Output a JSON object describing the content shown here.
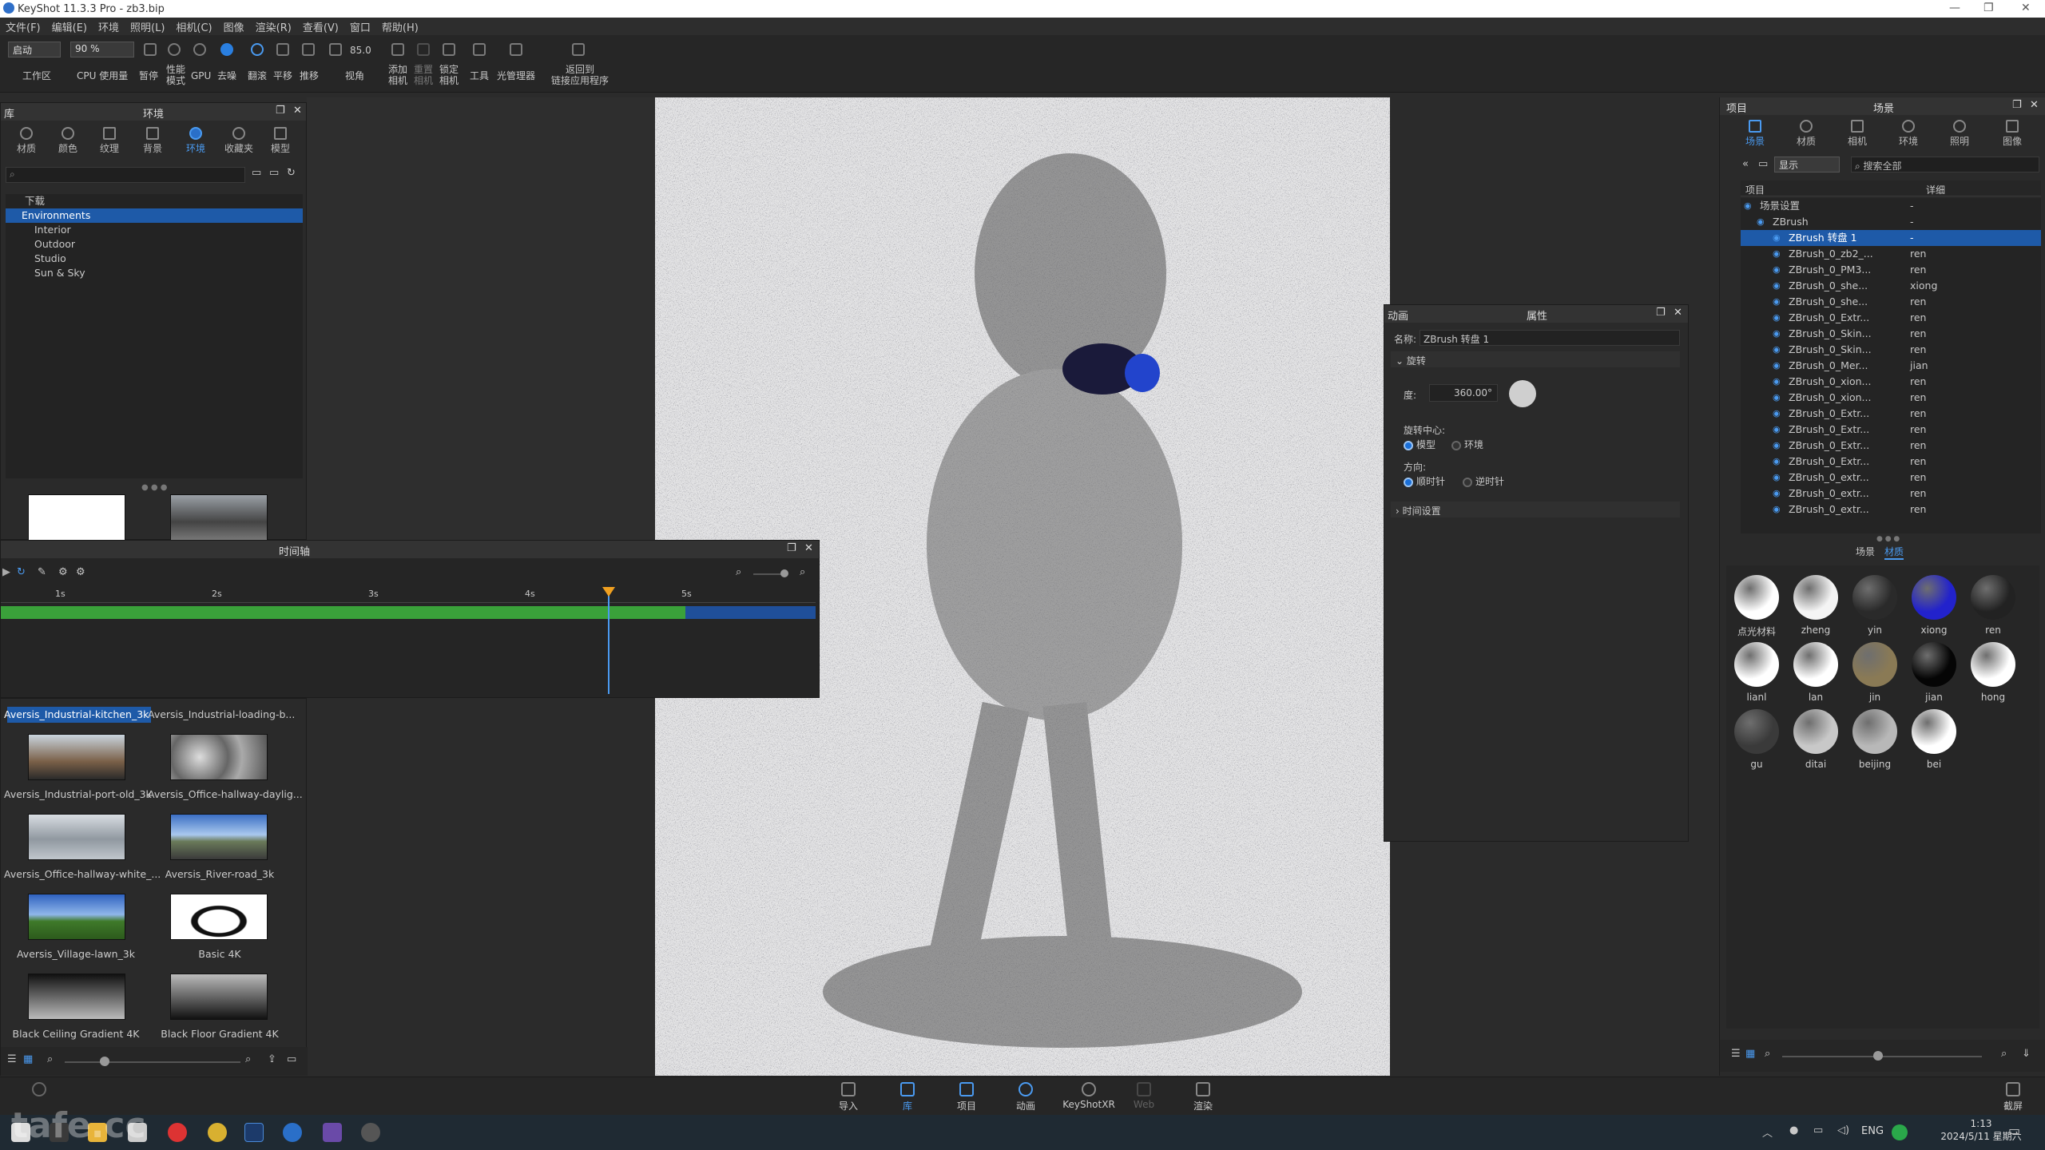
{
  "window": {
    "title": "KeyShot 11.3.3 Pro - zb3.bip"
  },
  "menu": [
    "文件(F)",
    "编辑(E)",
    "环境",
    "照明(L)",
    "相机(C)",
    "图像",
    "渲染(R)",
    "查看(V)",
    "窗口",
    "帮助(H)"
  ],
  "toolbar": {
    "mode_select": "启动",
    "zoom_select": "90 %",
    "fov_value": "85.0",
    "workspace": "工作区",
    "cpu": "CPU 使用量",
    "pause": "暂停",
    "perf": "性能\n模式",
    "gpu": "GPU",
    "denoise": "去噪",
    "rotate": "翻滚",
    "pan": "平移",
    "push": "推移",
    "view": "视角",
    "add_camera": "添加\n相机",
    "reset_camera": "重置\n相机",
    "lock_camera": "锁定\n相机",
    "tools": "工具",
    "light_manager": "光管理器",
    "back_to_link": "返回到\n链接应用程序"
  },
  "library": {
    "header_left": "库",
    "title": "环境",
    "tabs": [
      "材质",
      "颜色",
      "纹理",
      "背景",
      "环境",
      "收藏夹",
      "模型"
    ],
    "tree": [
      "下载",
      "Environments",
      "Interior",
      "Outdoor",
      "Studio",
      "Sun & Sky"
    ],
    "thumbnails": [
      {
        "name": "Aversis_Industrial-kitchen_3k"
      },
      {
        "name": "Aversis_Industrial-loading-b..."
      },
      {
        "name": "Aversis_Industrial-port-old_3k"
      },
      {
        "name": "Aversis_Office-hallway-daylig..."
      },
      {
        "name": "Aversis_Office-hallway-white_..."
      },
      {
        "name": "Aversis_River-road_3k"
      },
      {
        "name": "Aversis_Village-lawn_3k"
      },
      {
        "name": "Basic 4K"
      },
      {
        "name": "Black Ceiling Gradient 4K"
      },
      {
        "name": "Black Floor Gradient 4K"
      }
    ]
  },
  "timeline": {
    "title": "时间轴",
    "ticks": [
      "1s",
      "2s",
      "3s",
      "4s",
      "5s"
    ],
    "playhead": 0.745,
    "green_end": 0.84
  },
  "properties": {
    "left_label": "动画",
    "title": "属性",
    "name_label": "名称:",
    "name_value": "ZBrush 转盘 1",
    "section_rotate": "旋转",
    "degree_label": "度:",
    "degree_value": "360.00°",
    "center_label": "旋转中心:",
    "center_opt1": "模型",
    "center_opt2": "环境",
    "dir_label": "方向:",
    "dir_opt1": "顺时针",
    "dir_opt2": "逆时针",
    "section_time": "时间设置"
  },
  "project": {
    "header_left": "项目",
    "title": "场景",
    "tabs": [
      "场景",
      "材质",
      "相机",
      "环境",
      "照明",
      "图像"
    ],
    "filter_select": "显示",
    "search_placeholder": "搜索全部",
    "col_item": "项目",
    "col_detail": "详细",
    "rows": [
      {
        "name": "场景设置",
        "detail": "-"
      },
      {
        "name": "ZBrush",
        "detail": "-"
      },
      {
        "name": "ZBrush 转盘 1",
        "detail": "-"
      },
      {
        "name": "ZBrush_0_zb2_...",
        "detail": "ren"
      },
      {
        "name": "ZBrush_0_PM3...",
        "detail": "ren"
      },
      {
        "name": "ZBrush_0_she...",
        "detail": "xiong"
      },
      {
        "name": "ZBrush_0_she...",
        "detail": "ren"
      },
      {
        "name": "ZBrush_0_Extr...",
        "detail": "ren"
      },
      {
        "name": "ZBrush_0_Skin...",
        "detail": "ren"
      },
      {
        "name": "ZBrush_0_Skin...",
        "detail": "ren"
      },
      {
        "name": "ZBrush_0_Mer...",
        "detail": "jian"
      },
      {
        "name": "ZBrush_0_xion...",
        "detail": "ren"
      },
      {
        "name": "ZBrush_0_xion...",
        "detail": "ren"
      },
      {
        "name": "ZBrush_0_Extr...",
        "detail": "ren"
      },
      {
        "name": "ZBrush_0_Extr...",
        "detail": "ren"
      },
      {
        "name": "ZBrush_0_Extr...",
        "detail": "ren"
      },
      {
        "name": "ZBrush_0_Extr...",
        "detail": "ren"
      },
      {
        "name": "ZBrush_0_extr...",
        "detail": "ren"
      },
      {
        "name": "ZBrush_0_extr...",
        "detail": "ren"
      },
      {
        "name": "ZBrush_0_extr...",
        "detail": "ren"
      }
    ],
    "subtabs": [
      "场景",
      "材质"
    ],
    "materials": [
      {
        "name": "点光材料",
        "color": "#ffffff"
      },
      {
        "name": "zheng",
        "color": "#f4f4f4"
      },
      {
        "name": "yin",
        "color": "#2a2a2a"
      },
      {
        "name": "xiong",
        "color": "#2222cc"
      },
      {
        "name": "ren",
        "color": "#222222"
      },
      {
        "name": "lianl",
        "color": "#ffffff"
      },
      {
        "name": "lan",
        "color": "#ffffff"
      },
      {
        "name": "jin",
        "color": "#8a7a55"
      },
      {
        "name": "jian",
        "color": "#050505"
      },
      {
        "name": "hong",
        "color": "#ffffff"
      },
      {
        "name": "gu",
        "color": "#3a3a3a"
      },
      {
        "name": "ditai",
        "color": "#c8c8c8"
      },
      {
        "name": "beijing",
        "color": "#b8b8b8"
      },
      {
        "name": "bei",
        "color": "#ffffff"
      }
    ]
  },
  "bottombar": [
    "导入",
    "库",
    "项目",
    "动画",
    "KeyShotXR",
    "Web",
    "渲染",
    "截屏"
  ],
  "taskbar": {
    "lang": "ENG",
    "time": "1:13",
    "date": "2024/5/11 星期六"
  },
  "watermark": "tafe.cc"
}
